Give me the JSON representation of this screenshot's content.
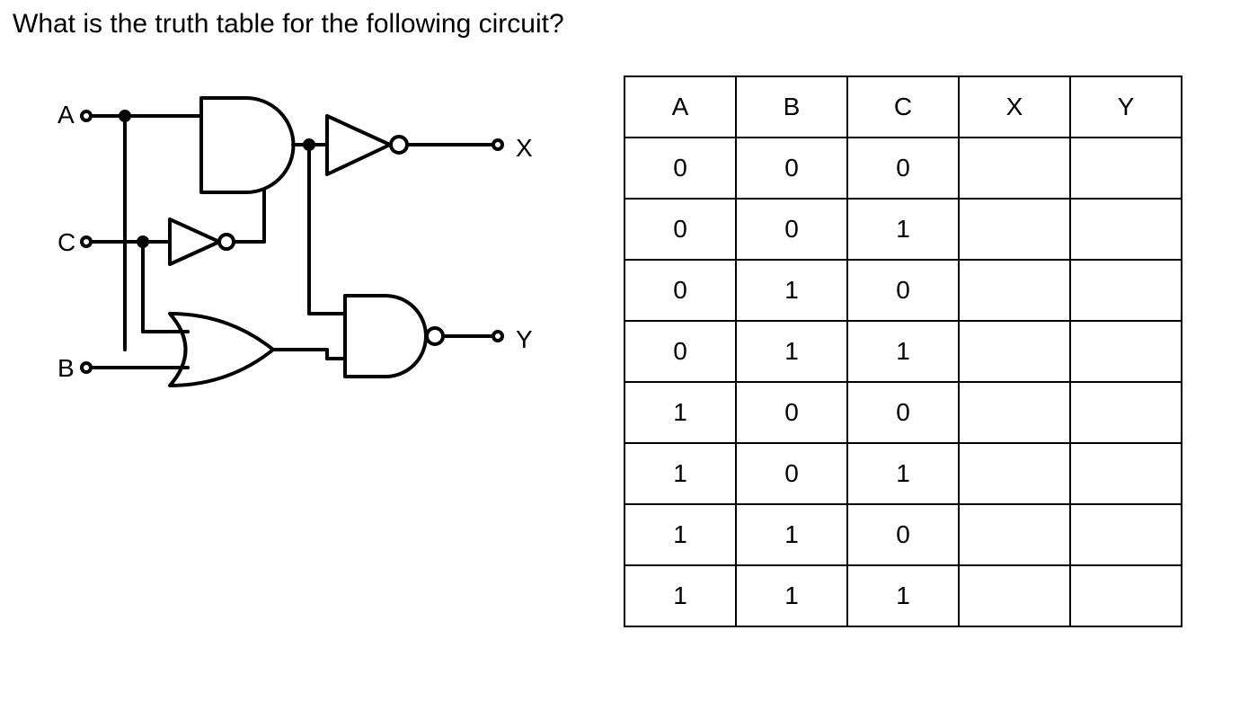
{
  "question": "What is the truth table for the following circuit?",
  "circuit": {
    "inputs": {
      "A": "A",
      "B": "B",
      "C": "C"
    },
    "outputs": {
      "X": "X",
      "Y": "Y"
    },
    "gates": [
      {
        "name": "and1",
        "type": "AND",
        "inputs": [
          "A",
          "NOT_C"
        ],
        "output": "W1"
      },
      {
        "name": "not1",
        "type": "NOT",
        "inputs": [
          "C"
        ],
        "output": "NOT_C"
      },
      {
        "name": "not2_buf_x",
        "type": "NOT/BUF",
        "inputs": [
          "W1"
        ],
        "output": "X"
      },
      {
        "name": "or1",
        "type": "OR",
        "inputs": [
          "C",
          "B"
        ],
        "output": "W2"
      },
      {
        "name": "nand1",
        "type": "NAND",
        "inputs": [
          "W1_branch",
          "W2"
        ],
        "output": "Y"
      }
    ]
  },
  "table": {
    "headers": [
      "A",
      "B",
      "C",
      "X",
      "Y"
    ],
    "rows": [
      [
        "0",
        "0",
        "0",
        "",
        ""
      ],
      [
        "0",
        "0",
        "1",
        "",
        ""
      ],
      [
        "0",
        "1",
        "0",
        "",
        ""
      ],
      [
        "0",
        "1",
        "1",
        "",
        ""
      ],
      [
        "1",
        "0",
        "0",
        "",
        ""
      ],
      [
        "1",
        "0",
        "1",
        "",
        ""
      ],
      [
        "1",
        "1",
        "0",
        "",
        ""
      ],
      [
        "1",
        "1",
        "1",
        "",
        ""
      ]
    ]
  }
}
